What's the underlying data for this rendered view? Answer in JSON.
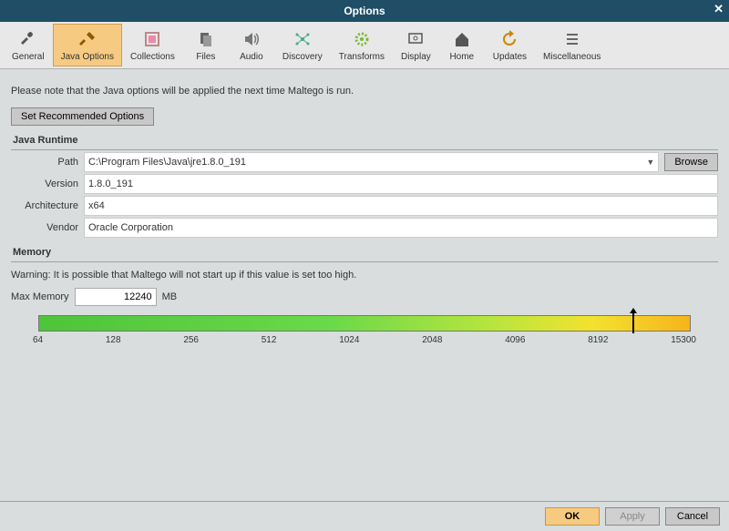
{
  "title": "Options",
  "toolbar": [
    {
      "label": "General"
    },
    {
      "label": "Java Options"
    },
    {
      "label": "Collections"
    },
    {
      "label": "Files"
    },
    {
      "label": "Audio"
    },
    {
      "label": "Discovery"
    },
    {
      "label": "Transforms"
    },
    {
      "label": "Display"
    },
    {
      "label": "Home"
    },
    {
      "label": "Updates"
    },
    {
      "label": "Miscellaneous"
    }
  ],
  "note": "Please note that the Java options will be applied the next time Maltego is run.",
  "setRecommended": "Set Recommended Options",
  "runtime": {
    "title": "Java Runtime",
    "pathLabel": "Path",
    "path": "C:\\Program Files\\Java\\jre1.8.0_191",
    "browse": "Browse",
    "versionLabel": "Version",
    "version": "1.8.0_191",
    "archLabel": "Architecture",
    "arch": "x64",
    "vendorLabel": "Vendor",
    "vendor": "Oracle Corporation"
  },
  "memory": {
    "title": "Memory",
    "warning": "Warning: It is possible that Maltego will not start up if this value is set too high.",
    "maxLabel": "Max Memory",
    "value": "12240",
    "unit": "MB",
    "ticks": [
      "64",
      "128",
      "256",
      "512",
      "1024",
      "2048",
      "4096",
      "8192",
      "15300"
    ]
  },
  "footer": {
    "ok": "OK",
    "apply": "Apply",
    "cancel": "Cancel"
  }
}
